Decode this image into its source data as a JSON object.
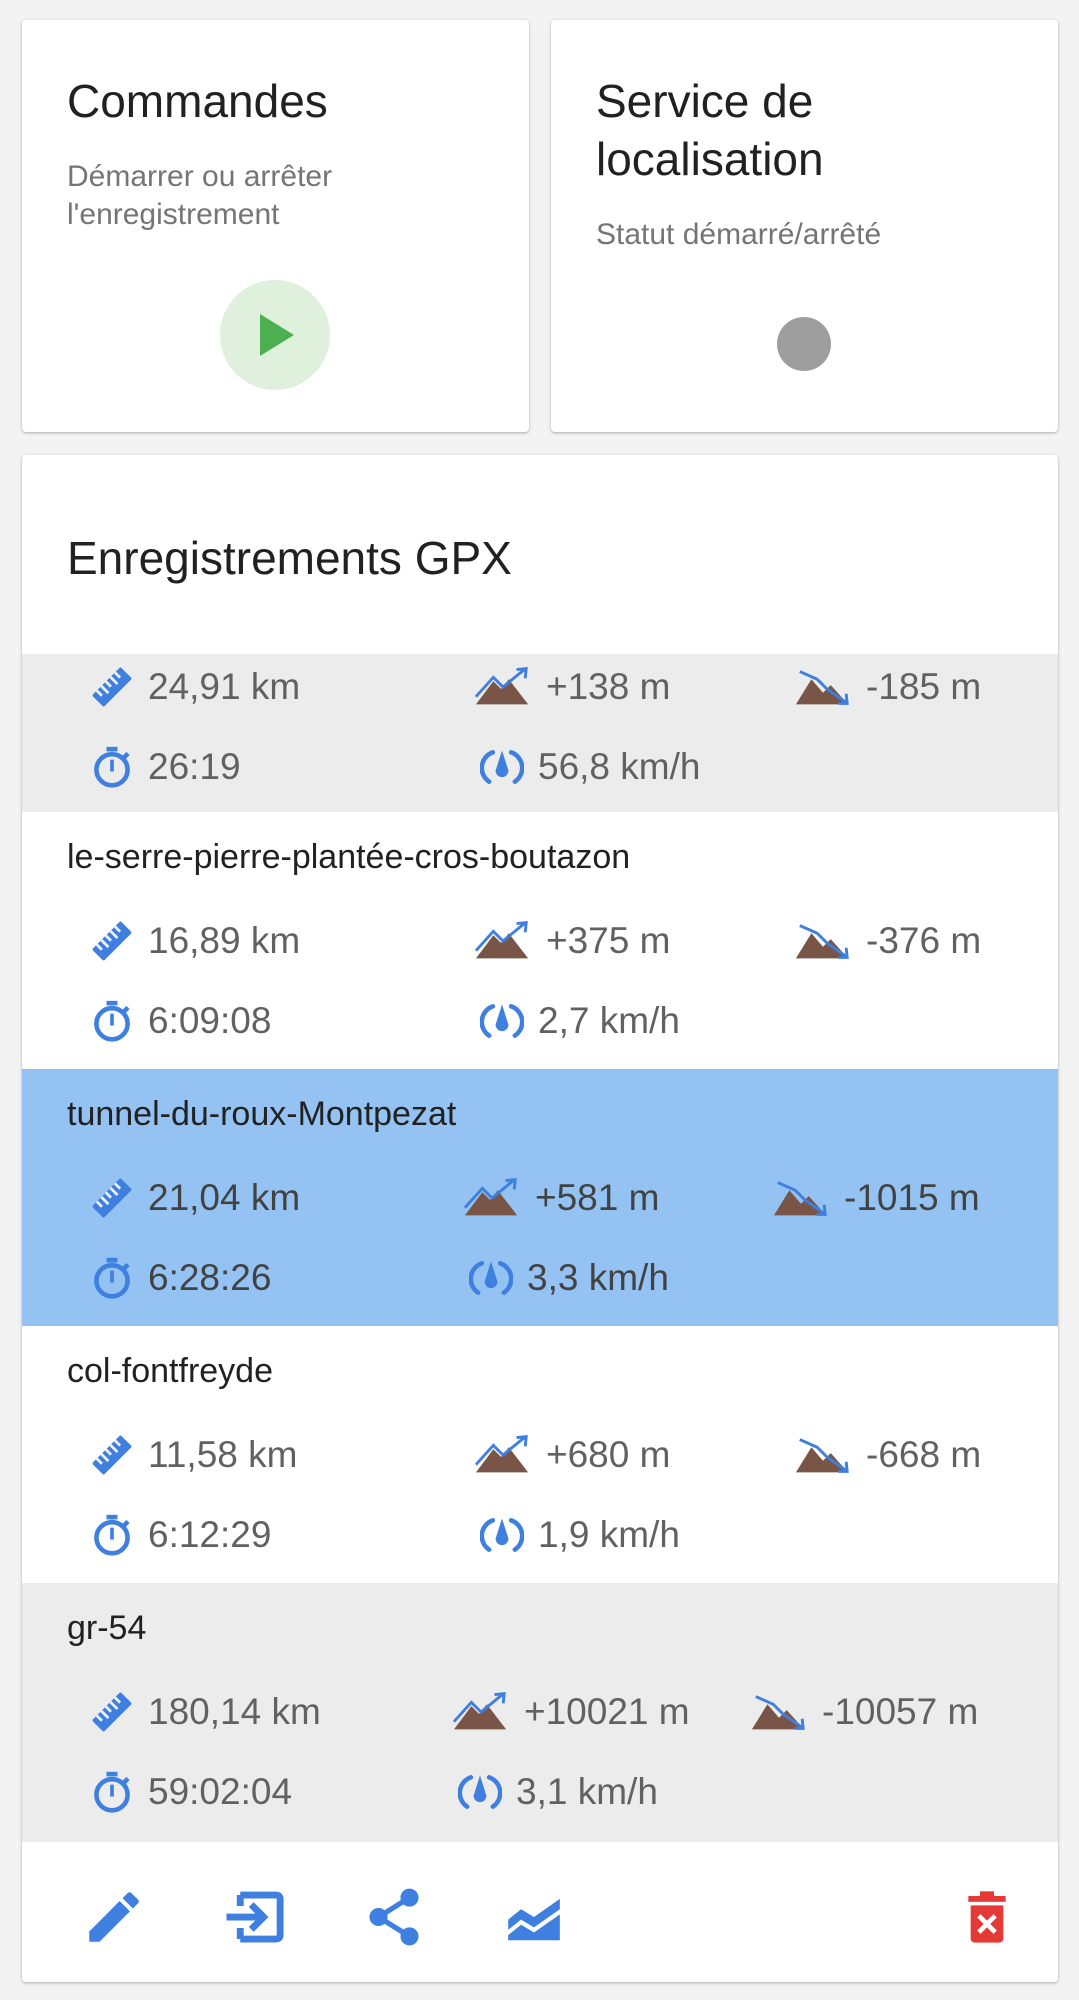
{
  "commands": {
    "title": "Commandes",
    "subtitle_line1": "Démarrer ou arrêter",
    "subtitle_line2": "l'enregistrement",
    "button_icon": "play-icon"
  },
  "location_service": {
    "title_line1": "Service de",
    "title_line2": "localisation",
    "subtitle": "Statut démarré/arrêté",
    "status_icon": "status-dot-icon",
    "status_color": "#9e9e9e"
  },
  "gpx": {
    "title": "Enregistrements GPX",
    "tracks": [
      {
        "name": "",
        "distance": "24,91 km",
        "ascent": "+138 m",
        "descent": "-185 m",
        "duration": "26:19",
        "speed": "56,8 km/h",
        "state": "gray"
      },
      {
        "name": "le-serre-pierre-plantée-cros-boutazon",
        "distance": "16,89 km",
        "ascent": "+375 m",
        "descent": "-376 m",
        "duration": "6:09:08",
        "speed": "2,7 km/h",
        "state": "white"
      },
      {
        "name": "tunnel-du-roux-Montpezat",
        "distance": "21,04 km",
        "ascent": "+581 m",
        "descent": "-1015 m",
        "duration": "6:28:26",
        "speed": "3,3 km/h",
        "state": "selected"
      },
      {
        "name": "col-fontfreyde",
        "distance": "11,58 km",
        "ascent": "+680 m",
        "descent": "-668 m",
        "duration": "6:12:29",
        "speed": "1,9 km/h",
        "state": "white"
      },
      {
        "name": "gr-54",
        "distance": "180,14 km",
        "ascent": "+10021 m",
        "descent": "-10057 m",
        "duration": "59:02:04",
        "speed": "3,1 km/h",
        "state": "gray"
      }
    ],
    "toolbar": [
      "pencil-icon",
      "import-icon",
      "share-icon",
      "chart-icon",
      "delete-icon"
    ]
  },
  "colors": {
    "accent_blue": "#3e7fe0",
    "selected_row": "#94c3f3",
    "gray_row": "#ececec",
    "mountain_brown": "#795548",
    "play_green": "#4caf50",
    "delete_red": "#e53935"
  }
}
